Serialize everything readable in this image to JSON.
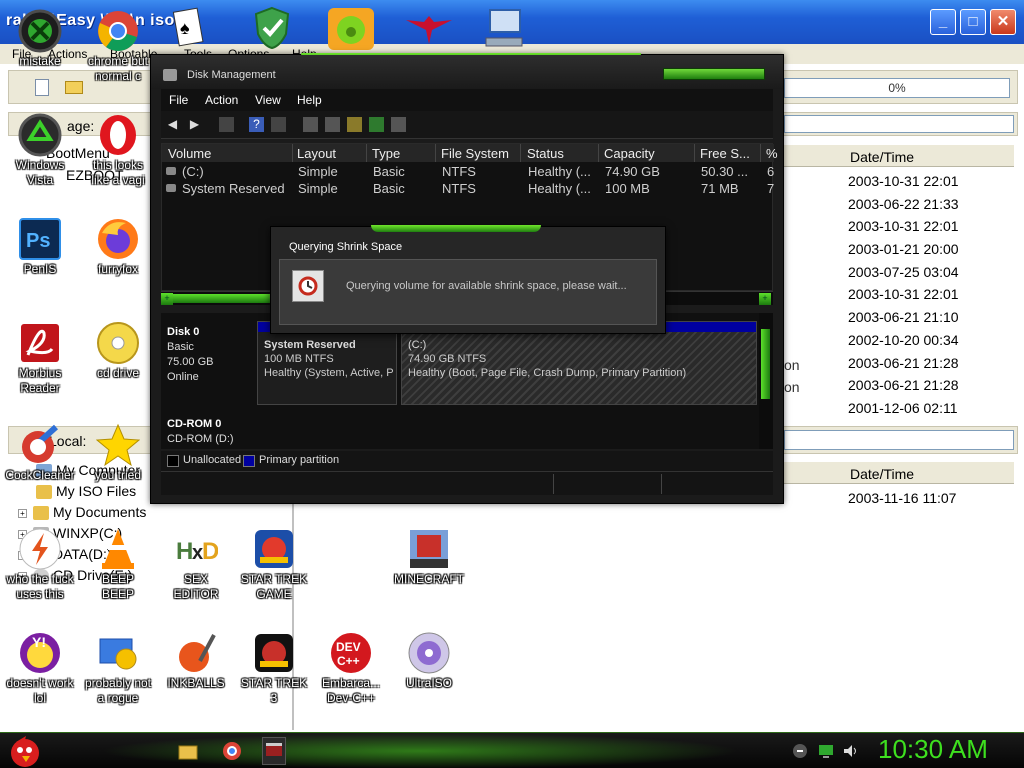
{
  "ultraiso": {
    "title": "ralSO\\Easy \\iso\\n iso",
    "menu": [
      "File",
      "Actions",
      "Bootable",
      "Tools",
      "Options",
      "Help"
    ],
    "progress": "0%",
    "path_label": "age:",
    "upper_date_header": "Date/Time",
    "upper_dates": [
      "2003-10-31 22:01",
      "2003-06-22 21:33",
      "2003-10-31 22:01",
      "2003-01-21 20:00",
      "2003-07-25 03:04",
      "2003-10-31 22:01",
      "2003-06-21 21:10",
      "2002-10-20 00:34",
      "2003-06-21 21:28",
      "2003-06-21 21:28",
      "2001-12-06 02:11"
    ],
    "upper_name_fragments": [
      "on",
      "on"
    ],
    "bootmenu_label": "BootMenu",
    "ezboot_label": "EZBOOT",
    "local_label": "Local:",
    "lower_date_header": "Date/Time",
    "lower_dates": [
      "2003-11-16 11:07"
    ],
    "tree": [
      {
        "label": "My Computer",
        "expander": ""
      },
      {
        "label": "My ISO Files",
        "expander": ""
      },
      {
        "label": "My Documents",
        "expander": "+"
      },
      {
        "label": "WINXP(C:)",
        "expander": "+"
      },
      {
        "label": "DATA(D:)",
        "expander": "+"
      },
      {
        "label": "CD Drive(E:)",
        "expander": "+"
      }
    ]
  },
  "desktop_icons": [
    {
      "label": "mistake",
      "icon": "xbox-icon"
    },
    {
      "label": "chrome but\nnormal c",
      "icon": "chrome-icon"
    },
    {
      "label": "Windows\nVista",
      "icon": "recycle-icon"
    },
    {
      "label": "this looks\nlike a vagi",
      "icon": "opera-icon"
    },
    {
      "label": "PenIS",
      "icon": "photoshop-icon"
    },
    {
      "label": "furryfox",
      "icon": "firefox-icon"
    },
    {
      "label": "Morbius\nReader",
      "icon": "acrobat-icon"
    },
    {
      "label": "cd drive",
      "icon": "cd-icon"
    },
    {
      "label": "CockCleaner",
      "icon": "ccleaner-icon"
    },
    {
      "label": "you tried",
      "icon": "star-icon"
    },
    {
      "label": "who the fuck\nuses this",
      "icon": "flash-icon"
    },
    {
      "label": "BEEP\nBEEP",
      "icon": "vlc-icon"
    },
    {
      "label": "SEX\nEDITOR",
      "icon": "hxd-icon"
    },
    {
      "label": "STAR TREK\nGAME",
      "icon": "angry-birds-star-wars-icon"
    },
    {
      "label": "MINECRAFT",
      "icon": "minecraft-icon"
    },
    {
      "label": "doesn't work\nlol",
      "icon": "yahoo-icon"
    },
    {
      "label": "probably not\na rogue",
      "icon": "program-icon"
    },
    {
      "label": "INKBALLS",
      "icon": "inkball-icon"
    },
    {
      "label": "STAR TREK\n3",
      "icon": "angry-birds-star-wars-icon"
    },
    {
      "label": "Embarca...\nDev-C++",
      "icon": "devcpp-icon"
    },
    {
      "label": "UltraISO",
      "icon": "ultraiso-icon"
    }
  ],
  "disk_management": {
    "title": "Disk Management",
    "menu": [
      "File",
      "Action",
      "View",
      "Help"
    ],
    "columns": [
      "Volume",
      "Layout",
      "Type",
      "File System",
      "Status",
      "Capacity",
      "Free S...",
      "%"
    ],
    "rows": [
      [
        "(C:)",
        "Simple",
        "Basic",
        "NTFS",
        "Healthy (...",
        "74.90 GB",
        "50.30 ...",
        "6"
      ],
      [
        "System Reserved",
        "Simple",
        "Basic",
        "NTFS",
        "Healthy (...",
        "100 MB",
        "71 MB",
        "7"
      ]
    ],
    "disk0": {
      "name": "Disk 0",
      "type": "Basic",
      "size": "75.00 GB",
      "status": "Online"
    },
    "partitions": [
      {
        "name": "System Reserved",
        "size": "100 MB NTFS",
        "status": "Healthy (System, Active, P"
      },
      {
        "name": "(C:)",
        "size": "74.90 GB NTFS",
        "status": "Healthy (Boot, Page File, Crash Dump, Primary Partition)"
      }
    ],
    "cdrom": {
      "name": "CD-ROM 0",
      "label": "CD-ROM (D:)"
    },
    "legend": [
      "Unallocated",
      "Primary partition"
    ],
    "colors": {
      "unallocated": "#000000",
      "primary": "#0000a0",
      "accent": "#3ee01f"
    }
  },
  "dialog": {
    "title": "Querying Shrink Space",
    "message": "Querying volume for available shrink space, please wait..."
  },
  "taskbar": {
    "clock": "10:30 AM"
  }
}
